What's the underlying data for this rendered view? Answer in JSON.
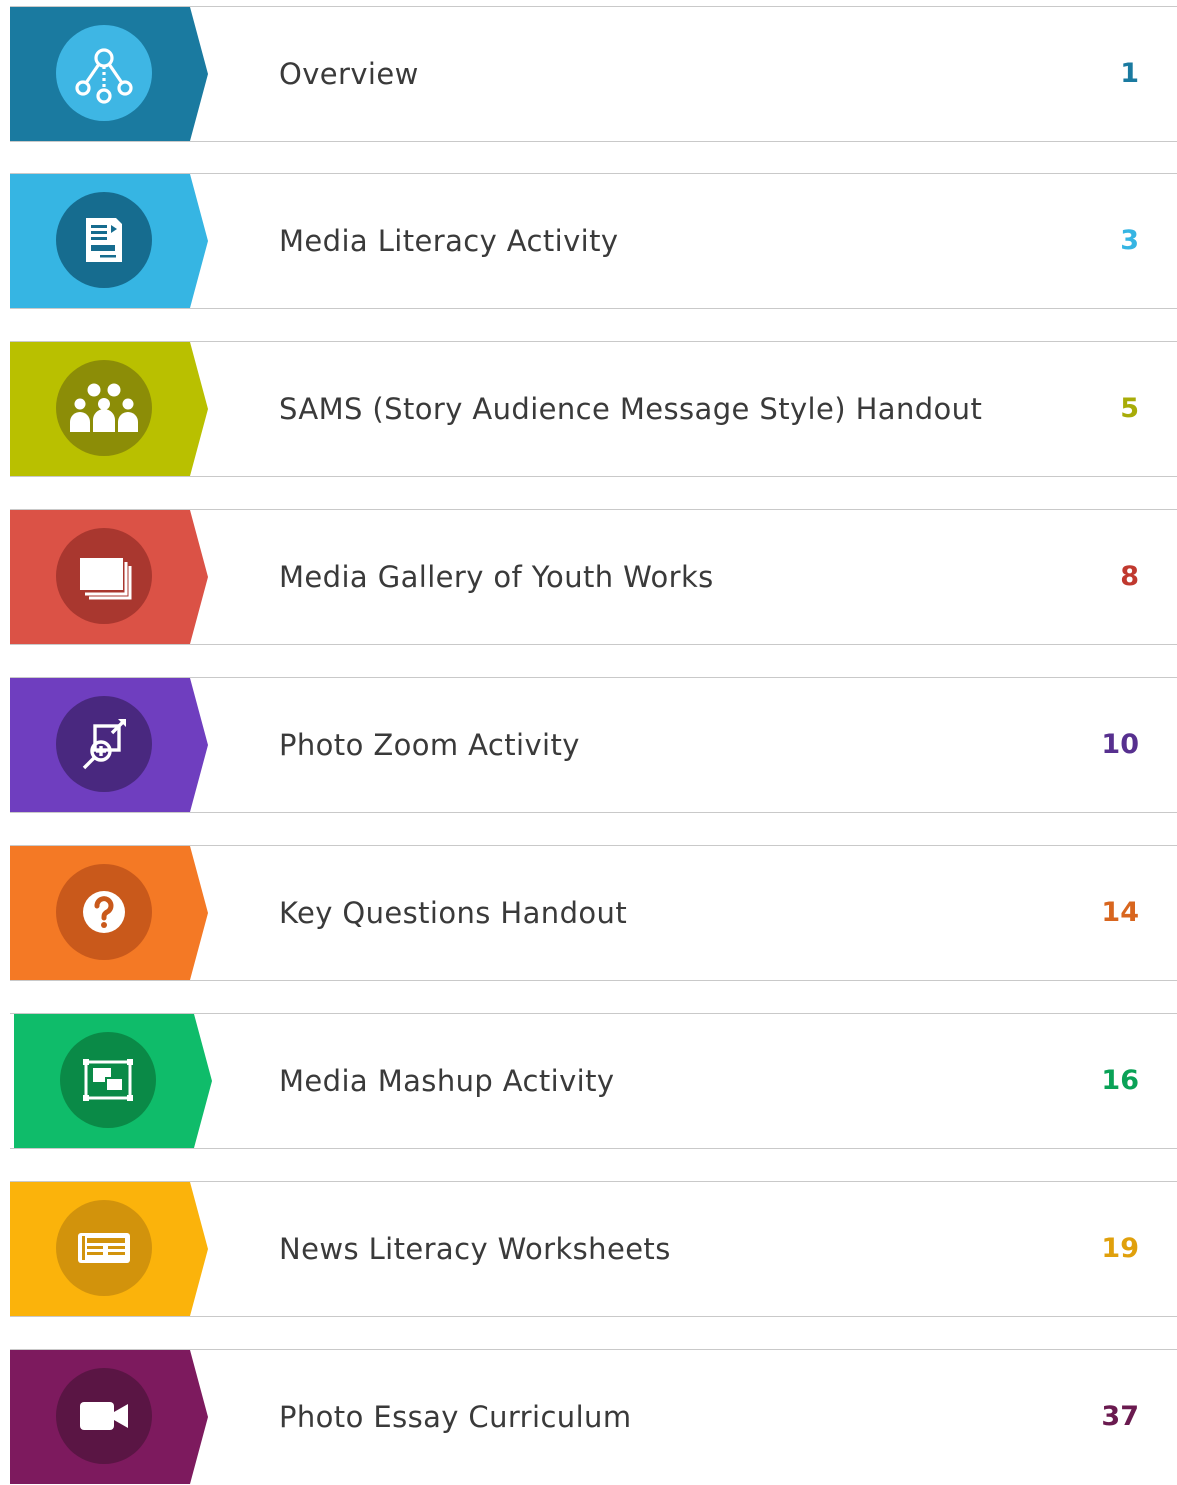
{
  "toc": {
    "items": [
      {
        "title": "Overview",
        "page": "1",
        "icon": "network-icon",
        "color": "#1a7aa0",
        "circle": "#3eb6e4",
        "page_color": "#1a7aa0"
      },
      {
        "title": "Media Literacy Activity",
        "page": "3",
        "icon": "document-icon",
        "color": "#36b5e3",
        "circle": "#166c8f",
        "page_color": "#36b5e3"
      },
      {
        "title": "SAMS (Story Audience Message Style) Handout",
        "page": "5",
        "icon": "audience-icon",
        "color": "#b9c000",
        "circle": "#8c8d07",
        "page_color": "#a8ac08"
      },
      {
        "title": "Media Gallery of Youth Works",
        "page": "8",
        "icon": "gallery-icon",
        "color": "#db5246",
        "circle": "#a9372f",
        "page_color": "#c0392f"
      },
      {
        "title": "Photo Zoom Activity",
        "page": "10",
        "icon": "zoom-icon",
        "color": "#6f3ebf",
        "circle": "#49287f",
        "page_color": "#57308f"
      },
      {
        "title": "Key Questions Handout",
        "page": "14",
        "icon": "question-icon",
        "color": "#f47925",
        "circle": "#c9591b",
        "page_color": "#d8661f"
      },
      {
        "title": "Media Mashup Activity",
        "page": "16",
        "icon": "mashup-icon",
        "color": "#0fbc6a",
        "circle": "#0a8a47",
        "page_color": "#0aa257"
      },
      {
        "title": "News Literacy Worksheets",
        "page": "19",
        "icon": "newspaper-icon",
        "color": "#fbb30b",
        "circle": "#d2930c",
        "page_color": "#e0a00c"
      },
      {
        "title": "Photo Essay Curriculum",
        "page": "37",
        "icon": "video-camera-icon",
        "color": "#7d1a5e",
        "circle": "#5a1544",
        "page_color": "#6a1a4f"
      }
    ]
  }
}
